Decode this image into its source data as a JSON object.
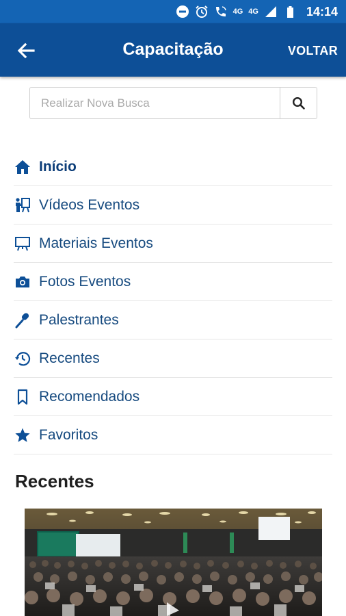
{
  "status_bar": {
    "network": "4G",
    "network2": "4G",
    "time": "14:14"
  },
  "app_bar": {
    "title": "Capacitação",
    "action_label": "VOLTAR"
  },
  "search": {
    "placeholder": "Realizar Nova Busca"
  },
  "menu": {
    "items": [
      {
        "label": "Início",
        "icon": "home-icon",
        "active": true
      },
      {
        "label": "Vídeos Eventos",
        "icon": "presenter-icon"
      },
      {
        "label": "Materiais Eventos",
        "icon": "easel-icon"
      },
      {
        "label": "Fotos Eventos",
        "icon": "camera-icon"
      },
      {
        "label": "Palestrantes",
        "icon": "microphone-icon"
      },
      {
        "label": "Recentes",
        "icon": "history-icon"
      },
      {
        "label": "Recomendados",
        "icon": "bookmark-icon"
      },
      {
        "label": "Favoritos",
        "icon": "star-icon"
      }
    ]
  },
  "recent": {
    "title": "Recentes"
  },
  "colors": {
    "status_bar": "#1464b4",
    "app_bar": "#0d4f97",
    "menu_text": "#164a7f",
    "icon": "#0d4f97"
  }
}
